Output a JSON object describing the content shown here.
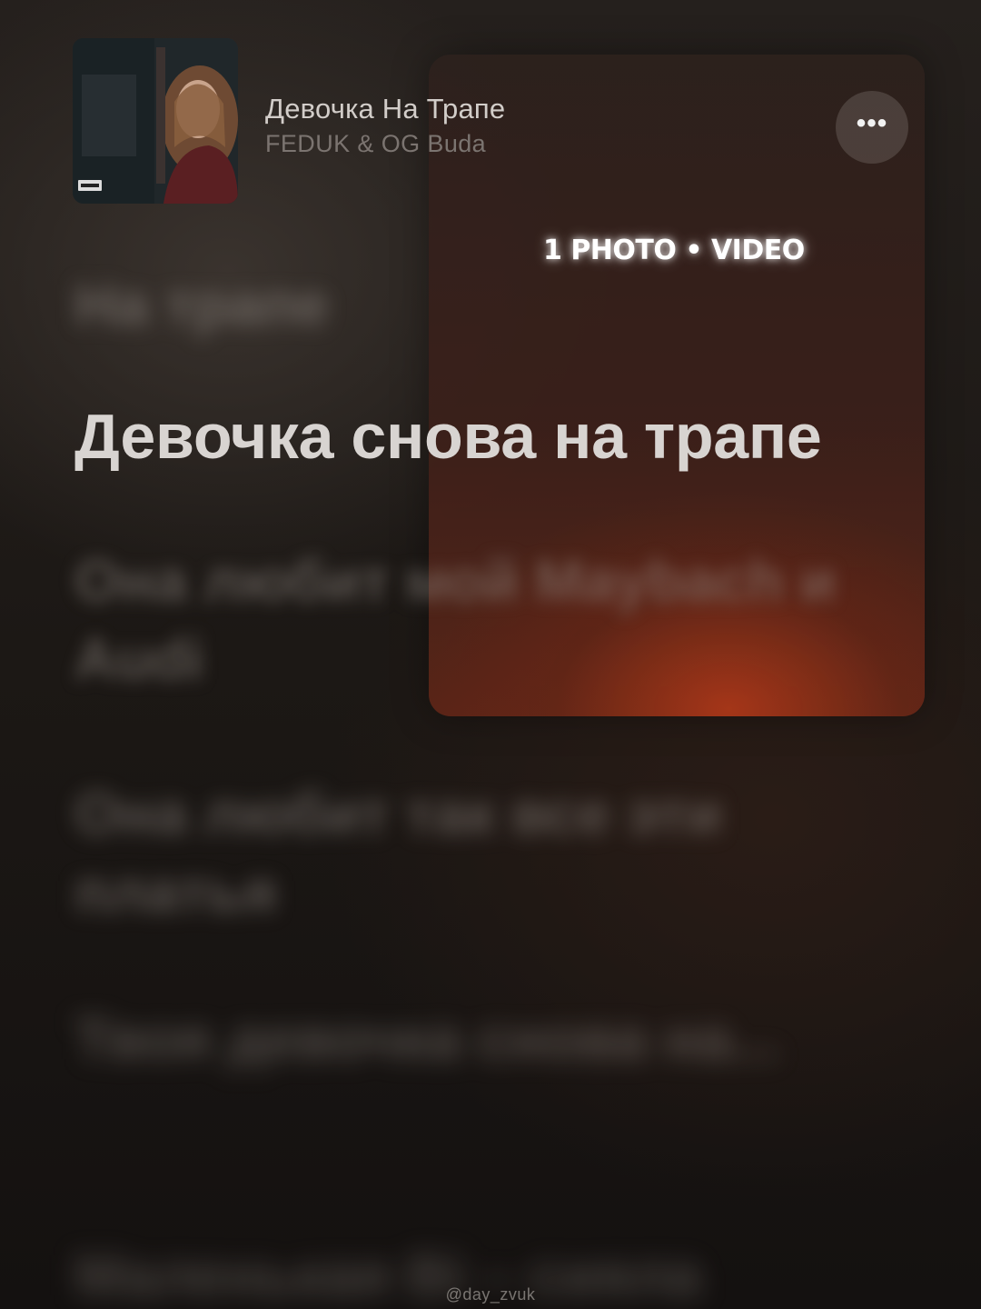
{
  "now_playing": {
    "title": "Девочка На Трапе",
    "artist": "FEDUK & OG Buda",
    "more_label": "•••"
  },
  "media_badge": "1 PHOTO • VIDEO",
  "lyrics": {
    "previous": "На трапе",
    "current": "Девочка снова на трапе",
    "upcoming": [
      "Она любит мой Maybach и Audi",
      "Она любит так все эти платья",
      "Твоя девочка снова на...",
      "Маленькая Bi – сияла"
    ]
  },
  "watermark": "@day_zvuk"
}
